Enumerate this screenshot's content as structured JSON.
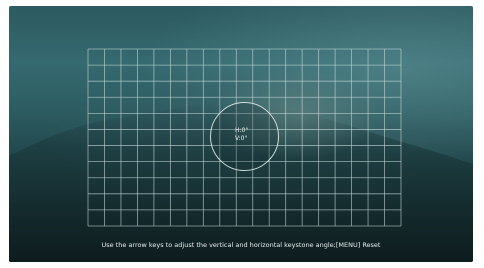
{
  "keystone": {
    "horizontal": "H:0°",
    "vertical": "V:0°"
  },
  "hint": "Use the arrow keys to adjust the vertical and horizontal keystone angle;[MENU] Reset",
  "grid": {
    "columns": 19,
    "rows": 11,
    "line_color": "#c9dcdc"
  }
}
